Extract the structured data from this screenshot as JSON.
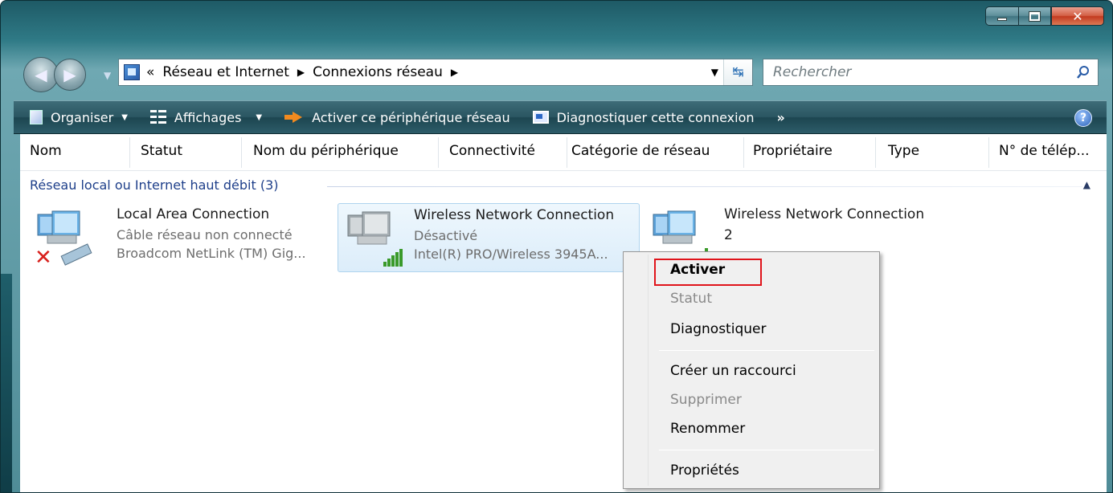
{
  "address": {
    "breadcrumb": [
      "Réseau et Internet",
      "Connexions réseau"
    ],
    "prefix": "«"
  },
  "search": {
    "placeholder": "Rechercher"
  },
  "toolbar": {
    "organize": "Organiser",
    "views": "Affichages",
    "activate": "Activer ce périphérique réseau",
    "diagnose": "Diagnostiquer cette connexion",
    "more": "»"
  },
  "columns": [
    "Nom",
    "Statut",
    "Nom du périphérique",
    "Connectivité",
    "Catégorie de réseau",
    "Propriétaire",
    "Type",
    "N° de télép..."
  ],
  "group": {
    "title": "Réseau local ou Internet haut débit (3)"
  },
  "items": [
    {
      "title": "Local Area Connection",
      "status": "Câble réseau non connecté",
      "device": "Broadcom NetLink (TM) Gig..."
    },
    {
      "title": "Wireless Network Connection",
      "status": "Désactivé",
      "device": "Intel(R) PRO/Wireless 3945A..."
    },
    {
      "title": "Wireless Network Connection",
      "title2": "2"
    }
  ],
  "context_menu": {
    "items": [
      {
        "label": "Activer",
        "style": "bold"
      },
      {
        "label": "Statut",
        "style": "disabled"
      },
      {
        "label": "Diagnostiquer",
        "style": "normal"
      },
      {
        "label": "Créer un raccourci",
        "style": "normal"
      },
      {
        "label": "Supprimer",
        "style": "disabled"
      },
      {
        "label": "Renommer",
        "style": "normal"
      },
      {
        "label": "Propriétés",
        "style": "normal"
      }
    ]
  },
  "colors": {
    "accent": "#1e3f8a",
    "highlight_box": "#e0141b",
    "toolbar": "#2a5561"
  }
}
